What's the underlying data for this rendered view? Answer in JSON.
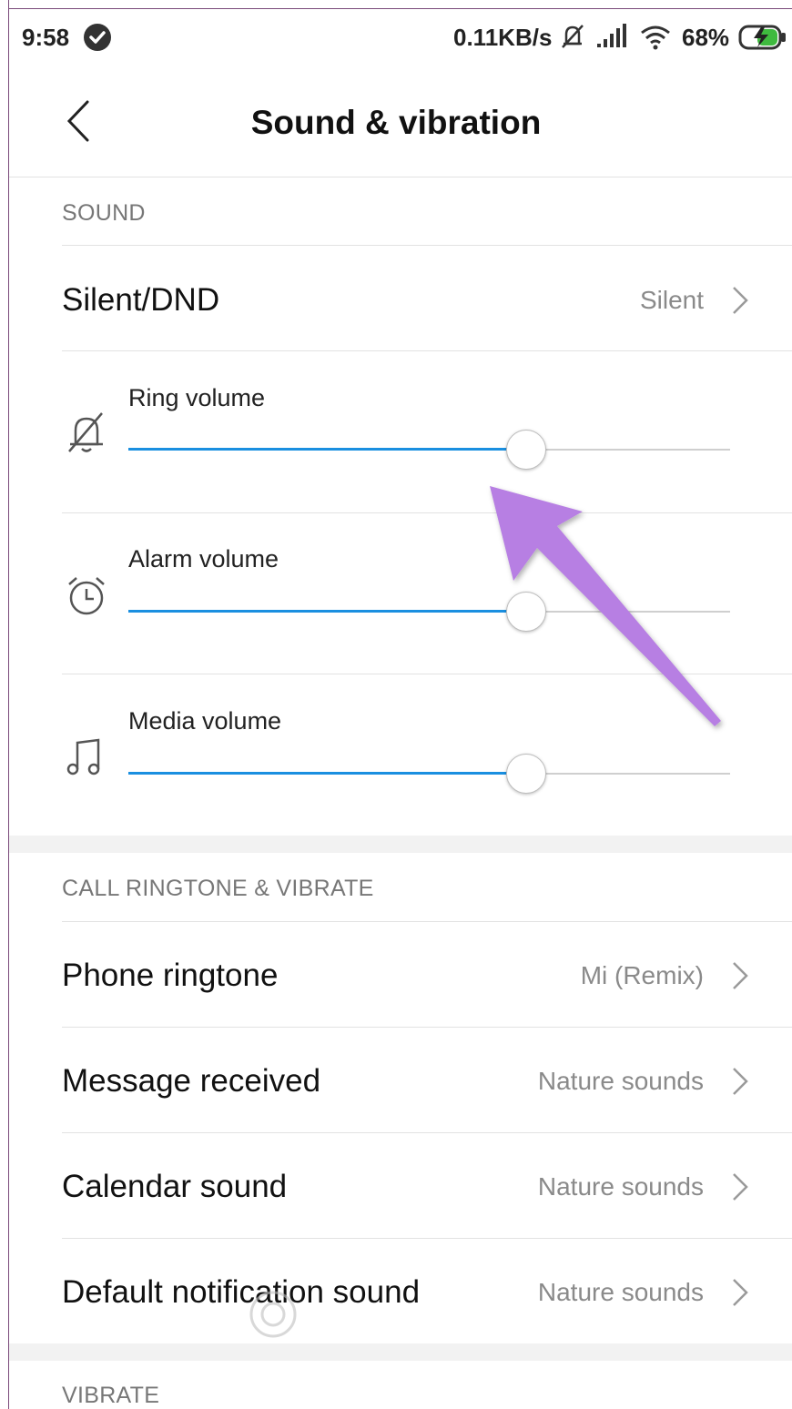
{
  "status_bar": {
    "time": "9:58",
    "speed": "0.11KB/s",
    "battery": "68%"
  },
  "header": {
    "title": "Sound & vibration"
  },
  "sound_section": {
    "label": "SOUND",
    "silent_dnd": {
      "title": "Silent/DND",
      "value": "Silent"
    },
    "volumes": [
      {
        "label": "Ring volume",
        "icon": "bell-muted-icon",
        "level": 0.66
      },
      {
        "label": "Alarm volume",
        "icon": "alarm-clock-icon",
        "level": 0.66
      },
      {
        "label": "Media volume",
        "icon": "music-note-icon",
        "level": 0.66
      }
    ]
  },
  "ringtone_section": {
    "label": "CALL RINGTONE & VIBRATE",
    "rows": [
      {
        "title": "Phone ringtone",
        "value": "Mi (Remix)"
      },
      {
        "title": "Message received",
        "value": "Nature sounds"
      },
      {
        "title": "Calendar sound",
        "value": "Nature sounds"
      },
      {
        "title": "Default notification sound",
        "value": "Nature sounds"
      }
    ]
  },
  "vibrate_section": {
    "label": "VIBRATE"
  },
  "colors": {
    "accent": "#1a8fe0",
    "annotation_arrow": "#b77fe3"
  }
}
